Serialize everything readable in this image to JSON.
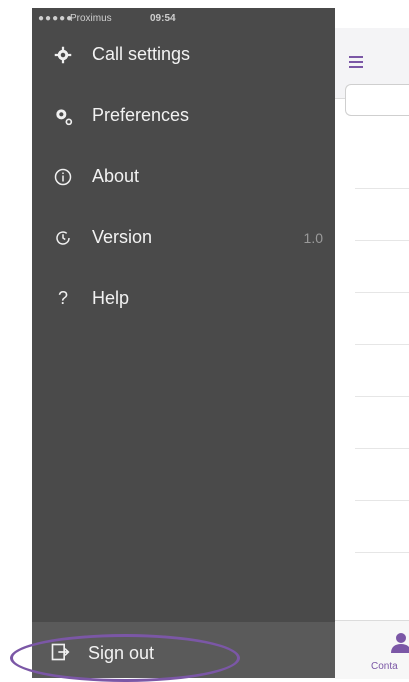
{
  "status_bar": {
    "carrier": "Proximus",
    "time": "09:54"
  },
  "menu": [
    {
      "icon": "gear-icon",
      "label": "Call settings"
    },
    {
      "icon": "preferences-gears-icon",
      "label": "Preferences"
    },
    {
      "icon": "info-icon",
      "label": "About"
    },
    {
      "icon": "clock-icon",
      "label": "Version",
      "value": "1.0"
    },
    {
      "icon": "question-icon",
      "label": "Help"
    }
  ],
  "signout": {
    "icon": "sign-out-icon",
    "label": "Sign out"
  },
  "app": {
    "tab_label": "Conta"
  },
  "colors": {
    "drawer_bg": "#4a4a4a",
    "accent": "#7b57a6"
  }
}
